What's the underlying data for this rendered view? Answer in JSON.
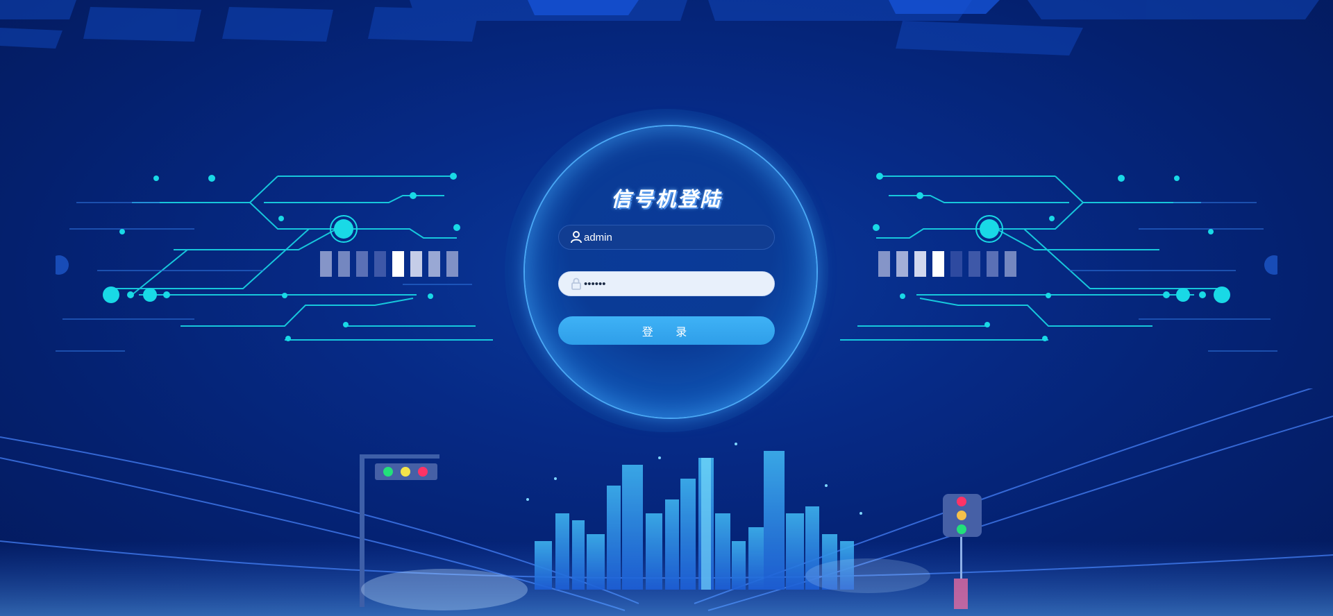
{
  "login": {
    "title": "信号机登陆",
    "username_value": "admin",
    "password_value": "••••••",
    "submit_label": "登 录"
  },
  "icons": {
    "username": "user-icon",
    "password": "lock-icon"
  },
  "colors": {
    "background": "#062a86",
    "accent_cyan": "#19e6e6",
    "button": "#35a8f0",
    "traffic_red": "#ff3366",
    "traffic_yellow": "#f4e34a",
    "traffic_green": "#22e07a"
  }
}
